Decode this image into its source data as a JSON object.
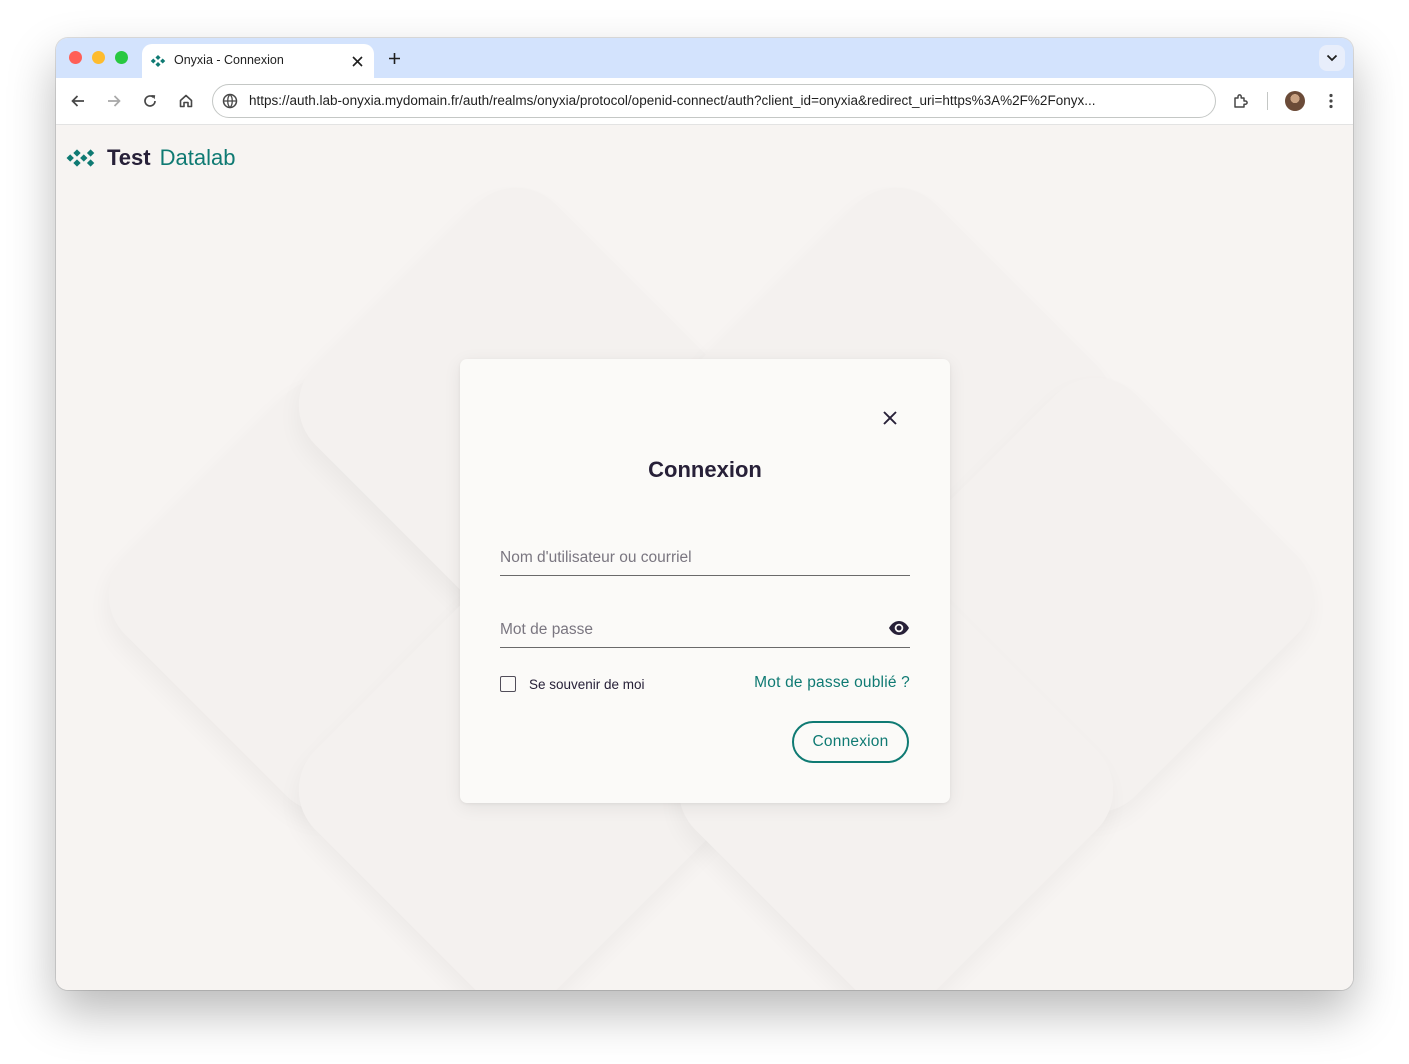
{
  "browser": {
    "tab_title": "Onyxia - Connexion",
    "url": "https://auth.lab-onyxia.mydomain.fr/auth/realms/onyxia/protocol/openid-connect/auth?client_id=onyxia&redirect_uri=https%3A%2F%2Fonyx..."
  },
  "brand": {
    "main": "Test",
    "accent": "Datalab"
  },
  "login": {
    "title": "Connexion",
    "username_placeholder": "Nom d'utilisateur ou courriel",
    "password_placeholder": "Mot de passe",
    "remember_label": "Se souvenir de moi",
    "forgot_label": "Mot de passe oublié ?",
    "submit_label": "Connexion"
  },
  "colors": {
    "accent": "#0f7a73",
    "text_dark": "#272038",
    "page_background": "#f7f4f2"
  }
}
